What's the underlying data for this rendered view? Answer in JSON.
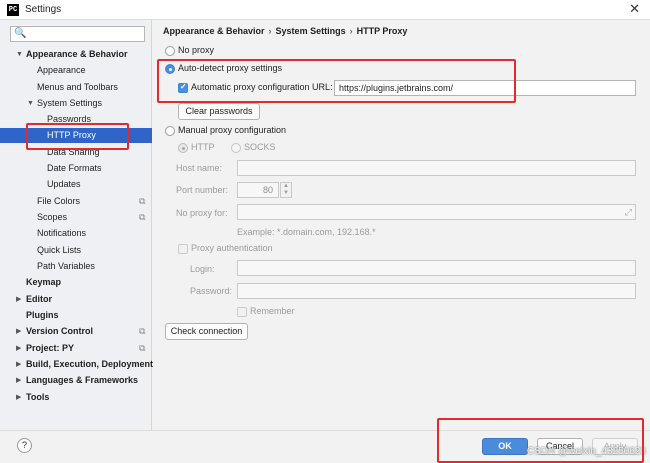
{
  "window": {
    "title": "Settings",
    "app_icon": "PC",
    "close_glyph": "✕"
  },
  "search": {
    "placeholder": "",
    "icon": "🔍"
  },
  "sidebar": {
    "items": [
      {
        "label": "Appearance & Behavior",
        "arrow": "▼"
      },
      {
        "label": "Appearance"
      },
      {
        "label": "Menus and Toolbars"
      },
      {
        "label": "System Settings",
        "arrow": "▼"
      },
      {
        "label": "Passwords"
      },
      {
        "label": "HTTP Proxy"
      },
      {
        "label": "Data Sharing"
      },
      {
        "label": "Date Formats"
      },
      {
        "label": "Updates"
      },
      {
        "label": "File Colors",
        "copy": "⧉"
      },
      {
        "label": "Scopes",
        "copy": "⧉"
      },
      {
        "label": "Notifications"
      },
      {
        "label": "Quick Lists"
      },
      {
        "label": "Path Variables"
      },
      {
        "label": "Keymap"
      },
      {
        "label": "Editor",
        "arrow": "▶"
      },
      {
        "label": "Plugins"
      },
      {
        "label": "Version Control",
        "arrow": "▶",
        "copy": "⧉"
      },
      {
        "label": "Project: PY",
        "arrow": "▶",
        "copy": "⧉"
      },
      {
        "label": "Build, Execution, Deployment",
        "arrow": "▶"
      },
      {
        "label": "Languages & Frameworks",
        "arrow": "▶"
      },
      {
        "label": "Tools",
        "arrow": "▶"
      }
    ]
  },
  "breadcrumb": {
    "part1": "Appearance & Behavior",
    "sep": "›",
    "part2": "System Settings",
    "part3": "HTTP Proxy"
  },
  "proxy": {
    "no_proxy": "No proxy",
    "auto_detect": "Auto-detect proxy settings",
    "auto_url_label": "Automatic proxy configuration URL:",
    "auto_url_value": "https://plugins.jetbrains.com/",
    "clear_passwords": "Clear passwords",
    "manual": "Manual proxy configuration",
    "http": "HTTP",
    "socks": "SOCKS",
    "host_label": "Host name:",
    "port_label": "Port number:",
    "port_value": "80",
    "no_proxy_for_label": "No proxy for:",
    "example": "Example: *.domain.com, 192.168.*",
    "proxy_auth": "Proxy authentication",
    "login_label": "Login:",
    "password_label": "Password:",
    "remember": "Remember",
    "check_connection": "Check connection"
  },
  "footer": {
    "help": "?",
    "ok": "OK",
    "cancel": "Cancel",
    "apply": "Apply",
    "watermark": "CSDN @weixin_43250623"
  },
  "colors": {
    "accent": "#2f65ca",
    "highlight_box": "#e32b2b",
    "primary_button": "#4a8bdb"
  }
}
